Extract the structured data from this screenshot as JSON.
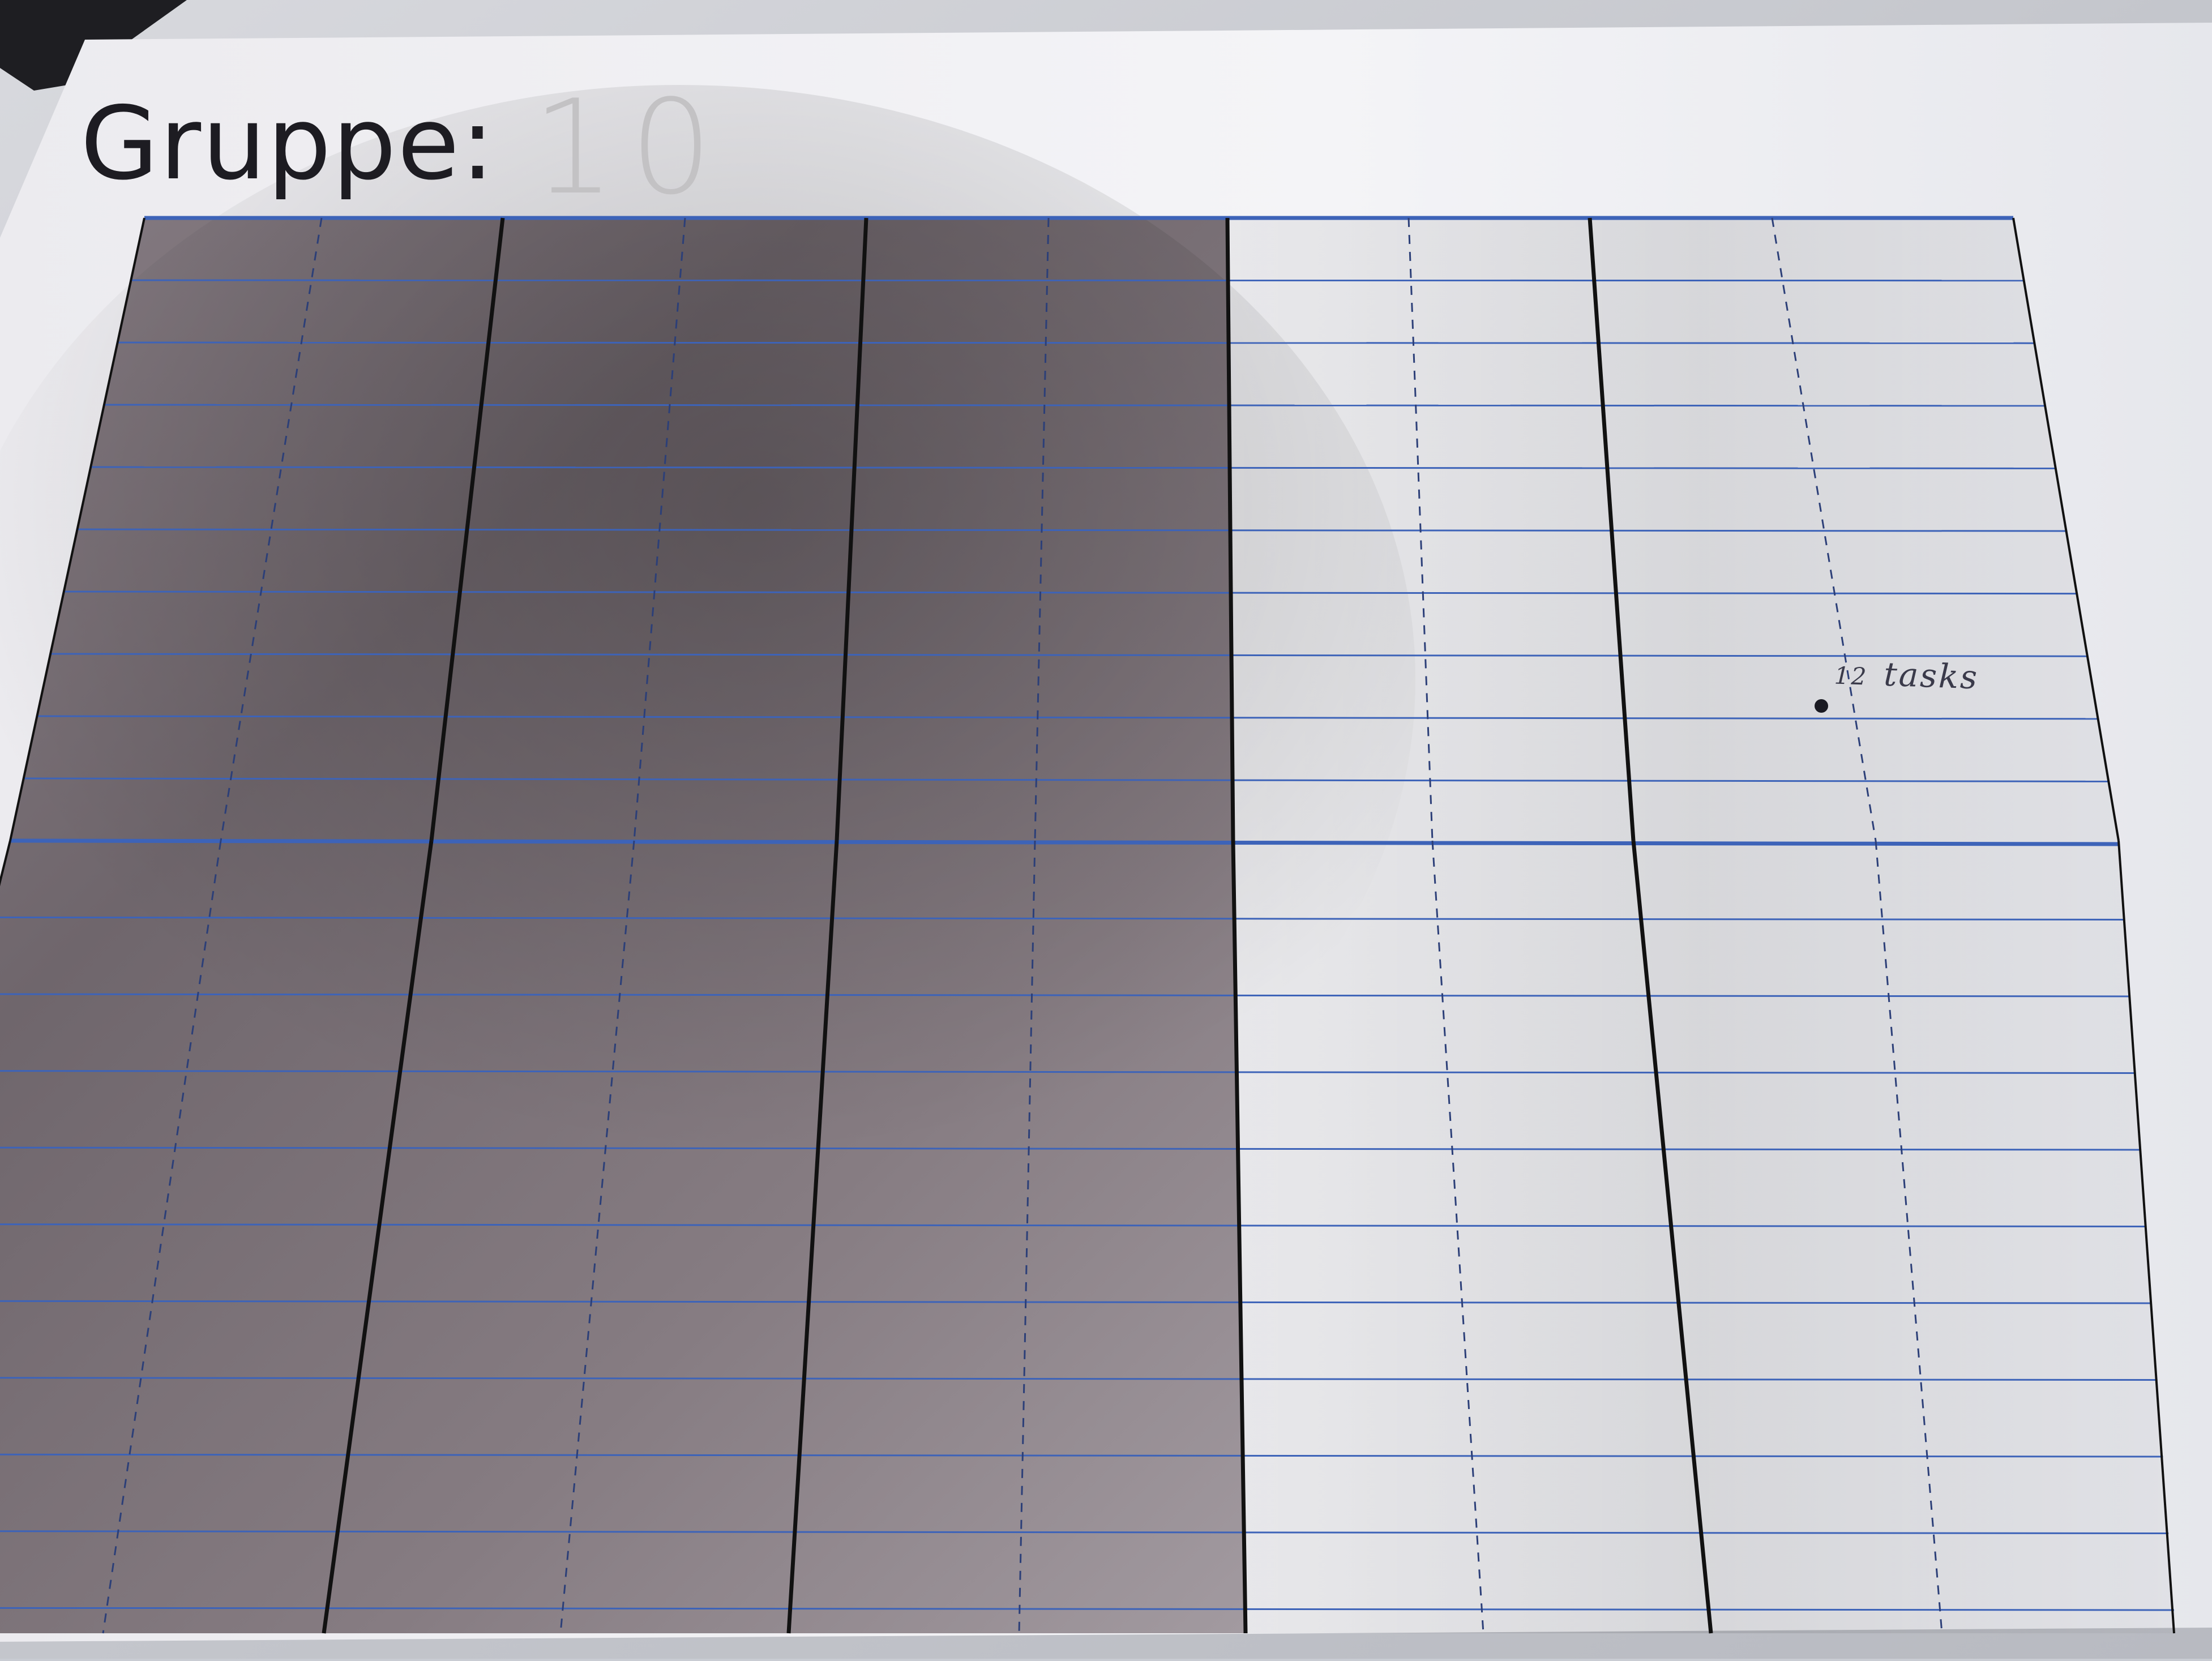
{
  "sheet": {
    "title": "Gruppe:",
    "group_number": "10",
    "columns": 5,
    "shaded_columns": 3,
    "rows_top_section": 10,
    "rows_bottom_section": 10
  },
  "annotation": {
    "number": "12",
    "text": "tasks"
  }
}
